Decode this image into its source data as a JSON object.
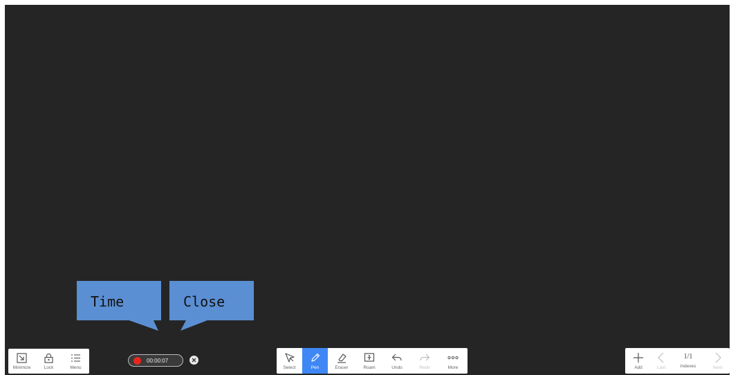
{
  "callouts": {
    "time": "Time",
    "close": "Close"
  },
  "recording": {
    "elapsed": "00:00:07"
  },
  "left_toolbar": {
    "minimize": "Minimize",
    "lock": "Lock",
    "menu": "Menu"
  },
  "center_toolbar": {
    "select": "Select",
    "pen": "Pen",
    "eraser": "Eraser",
    "roam": "Roam",
    "undo": "Undo",
    "redo": "Redo",
    "more": "More"
  },
  "right_toolbar": {
    "add": "Add",
    "last": "Last",
    "page": "1/1",
    "indexes": "Indexes",
    "next": "Next"
  },
  "colors": {
    "board": "#252525",
    "accent": "#3f87f5",
    "callout": "#5b8fd4",
    "record": "#e8261f"
  }
}
